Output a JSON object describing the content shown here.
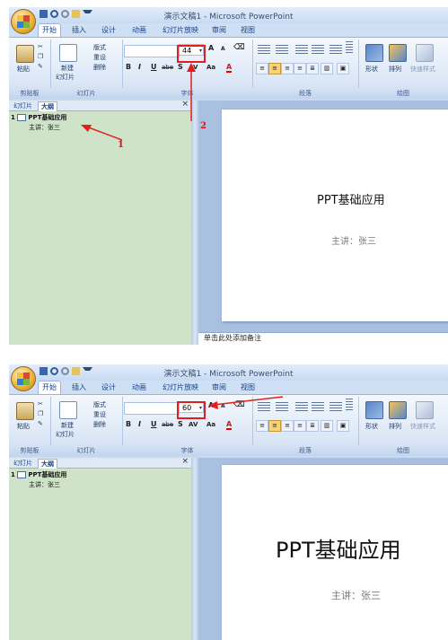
{
  "app": {
    "title": "演示文稿1 - Microsoft PowerPoint",
    "tabs": [
      "开始",
      "插入",
      "设计",
      "动画",
      "幻灯片放映",
      "审阅",
      "视图"
    ],
    "active_tab": "开始"
  },
  "ribbon": {
    "clipboard": {
      "paste": "粘贴",
      "label": "剪贴板"
    },
    "slides": {
      "new_slide": "新建",
      "new_slide2": "幻灯片",
      "layout": "版式",
      "reset": "重设",
      "delete": "删除",
      "label": "幻灯片"
    },
    "font": {
      "label": "字体",
      "grow": "A",
      "shrink": "A",
      "bold": "B",
      "italic": "I",
      "underline": "U",
      "strike": "abe",
      "shadow": "S",
      "spacing": "AV",
      "case": "Aa",
      "color": "A"
    },
    "paragraph": {
      "label": "段落"
    },
    "drawing": {
      "shape": "形状",
      "arrange": "排列",
      "quick_styles": "快速样式",
      "label": "绘图"
    }
  },
  "panel": {
    "tab_slides": "幻灯片",
    "tab_outline": "大纲",
    "close": "×"
  },
  "slide": {
    "title": "PPT基础应用",
    "subtitle": "主讲：张三"
  },
  "shot1": {
    "font_size": "44",
    "notes": "单击此处添加备注",
    "num1": "1",
    "num2": "2"
  },
  "shot2": {
    "font_size": "60"
  },
  "colors": {
    "annotation": "#e02020",
    "outline_panel": "#cfe3c9",
    "ribbon": "#dbe7f6"
  }
}
